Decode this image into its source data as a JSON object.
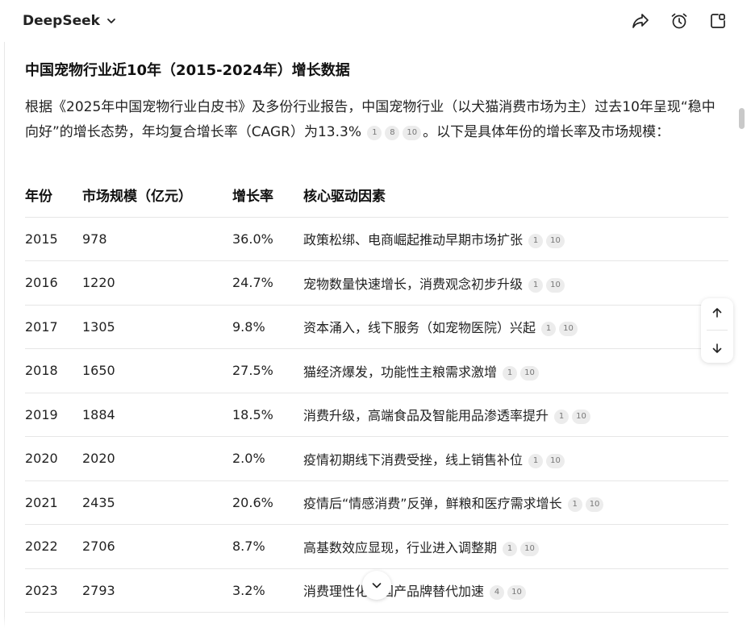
{
  "app": {
    "name": "DeepSeek"
  },
  "article": {
    "heading": "中国宠物行业近10年（2015-2024年）增长数据",
    "intro_text": "根据《2025年中国宠物行业白皮书》及多份行业报告，中国宠物行业（以犬猫消费市场为主）过去10年呈现“稳中向好”的增长态势，年均复合增长率（CAGR）为13.3%",
    "intro_citations": [
      "1",
      "8",
      "10"
    ],
    "intro_tail": "。以下是具体年份的增长率及市场规模："
  },
  "table": {
    "headers": [
      "年份",
      "市场规模（亿元）",
      "增长率",
      "核心驱动因素"
    ],
    "rows": [
      {
        "year": "2015",
        "size": "978",
        "growth": "36.0%",
        "driver": "政策松绑、电商崛起推动早期市场扩张",
        "cites": [
          "1",
          "10"
        ]
      },
      {
        "year": "2016",
        "size": "1220",
        "growth": "24.7%",
        "driver": "宠物数量快速增长，消费观念初步升级",
        "cites": [
          "1",
          "10"
        ]
      },
      {
        "year": "2017",
        "size": "1305",
        "growth": "9.8%",
        "driver": "资本涌入，线下服务（如宠物医院）兴起",
        "cites": [
          "1",
          "10"
        ]
      },
      {
        "year": "2018",
        "size": "1650",
        "growth": "27.5%",
        "driver": "猫经济爆发，功能性主粮需求激增",
        "cites": [
          "1",
          "10"
        ]
      },
      {
        "year": "2019",
        "size": "1884",
        "growth": "18.5%",
        "driver": "消费升级，高端食品及智能用品渗透率提升",
        "cites": [
          "1",
          "10"
        ]
      },
      {
        "year": "2020",
        "size": "2020",
        "growth": "2.0%",
        "driver": "疫情初期线下消费受挫，线上销售补位",
        "cites": [
          "1",
          "10"
        ]
      },
      {
        "year": "2021",
        "size": "2435",
        "growth": "20.6%",
        "driver": "疫情后“情感消费”反弹，鲜粮和医疗需求增长",
        "cites": [
          "1",
          "10"
        ]
      },
      {
        "year": "2022",
        "size": "2706",
        "growth": "8.7%",
        "driver": "高基数效应显现，行业进入调整期",
        "cites": [
          "1",
          "10"
        ]
      },
      {
        "year": "2023",
        "size": "2793",
        "growth": "3.2%",
        "driver": "消费理性化，国产品牌替代加速",
        "cites": [
          "4",
          "10"
        ]
      }
    ]
  },
  "icons": {
    "brand_dropdown": "chevron-down-icon",
    "share": "share-icon",
    "reminder": "alarm-icon",
    "new_chat": "new-chat-icon",
    "scroll_up": "arrow-up-icon",
    "scroll_down": "arrow-down-icon",
    "jump_bottom": "chevron-down-icon"
  },
  "colors": {
    "text": "#1f1f1f",
    "citation_bg": "#ececec",
    "border": "#e6e6e6"
  }
}
